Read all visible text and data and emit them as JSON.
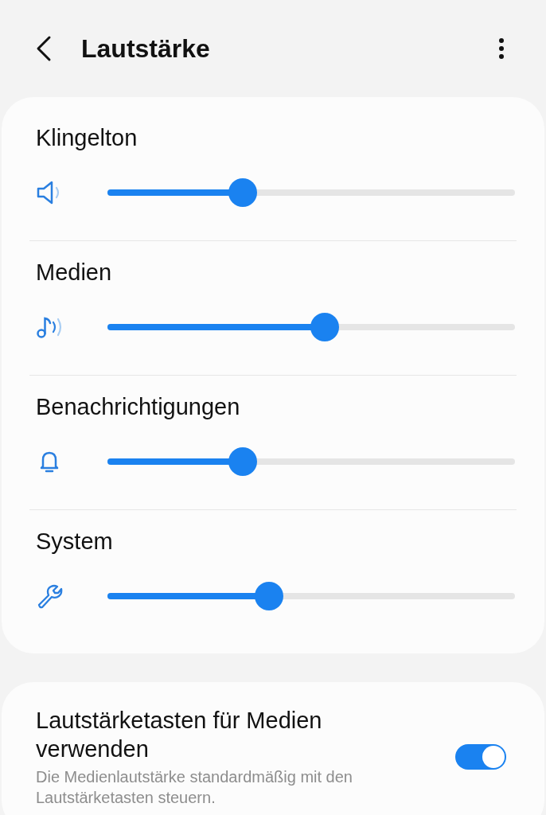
{
  "header": {
    "title": "Lautstärke"
  },
  "volumes": [
    {
      "label": "Klingelton",
      "kind": "ringtone",
      "level": 0.333
    },
    {
      "label": "Medien",
      "kind": "media",
      "level": 0.534
    },
    {
      "label": "Benachrichtigungen",
      "kind": "notification",
      "level": 0.333
    },
    {
      "label": "System",
      "kind": "system",
      "level": 0.397
    }
  ],
  "media_keys": {
    "title": "Lautstärketasten für Medien verwenden",
    "description": "Die Medienlautstärke standardmäßig mit den Lautstärketasten steuern.",
    "on": true
  }
}
